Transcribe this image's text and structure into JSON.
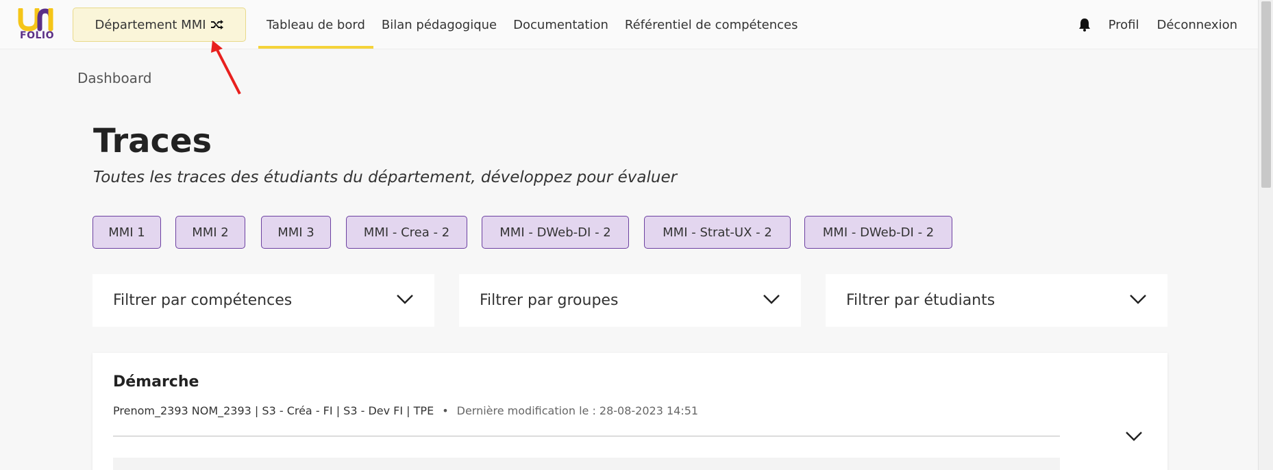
{
  "header": {
    "logo": {
      "top": "UNI",
      "bottom": "FOLIO"
    },
    "department_button": "Département MMI",
    "nav": [
      "Tableau de bord",
      "Bilan pédagogique",
      "Documentation",
      "Référentiel de compétences"
    ],
    "active_nav": "Tableau de bord",
    "profile": "Profil",
    "logout": "Déconnexion"
  },
  "breadcrumb": "Dashboard",
  "page": {
    "title": "Traces",
    "subtitle": "Toutes les traces des étudiants du département, développez pour évaluer"
  },
  "groups": [
    "MMI 1",
    "MMI 2",
    "MMI 3",
    "MMI - Crea - 2",
    "MMI - DWeb-DI - 2",
    "MMI - Strat-UX - 2",
    "MMI - DWeb-DI - 2"
  ],
  "filters": [
    "Filtrer par compétences",
    "Filtrer par groupes",
    "Filtrer par étudiants"
  ],
  "trace_card": {
    "title": "Démarche",
    "author": "Prenom_2393 NOM_2393 | S3 - Créa - FI | S3 - Dev FI | TPE",
    "separator": "•",
    "modified": "Dernière modification le : 28-08-2023 14:51"
  },
  "colors": {
    "accent_yellow": "#f5d33a",
    "chip_purple_bg": "#e3d6ef",
    "chip_purple_border": "#6b3fa0",
    "logo_purple": "#5b2f86",
    "annotation_red": "#e8201e"
  }
}
